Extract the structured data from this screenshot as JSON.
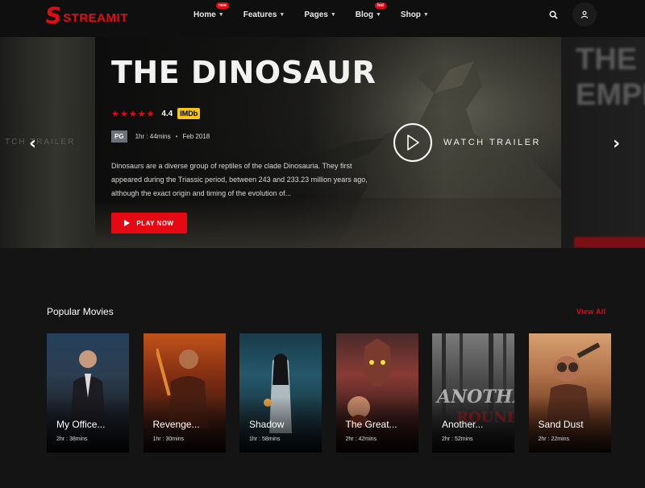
{
  "header": {
    "logo_letter": "S",
    "logo_text": "STREAMIT",
    "nav": [
      {
        "label": "Home",
        "badge": "new"
      },
      {
        "label": "Features",
        "badge": ""
      },
      {
        "label": "Pages",
        "badge": ""
      },
      {
        "label": "Blog",
        "badge": "hot"
      },
      {
        "label": "Shop",
        "badge": ""
      }
    ]
  },
  "hero": {
    "title": "THE DINOSAUR",
    "stars": "★★★★★",
    "rating": "4.4",
    "imdb": "IMDb",
    "certificate": "PG",
    "duration": "1hr : 44mins",
    "date": "Feb 2018",
    "description": "Dinosaurs are a diverse group of reptiles of the clade Dinosauria. They first appeared during the Triassic period, between 243 and 233.23 million years ago, although the exact origin and timing of the evolution of...",
    "play_label": "PLAY NOW",
    "trailer_label": "WATCH TRAILER",
    "prev_ghost": "TCH TRAILER",
    "next_ghost": "THE EMPI"
  },
  "popular": {
    "title": "Popular Movies",
    "view_all": "View All",
    "movies": [
      {
        "title": "My Office...",
        "duration": "2hr : 38mins"
      },
      {
        "title": "Revenge...",
        "duration": "1hr : 30mins"
      },
      {
        "title": "Shadow",
        "duration": "1hr : 58mins"
      },
      {
        "title": "The Great...",
        "duration": "2hr : 42mins"
      },
      {
        "title": "Another...",
        "duration": "2hr : 52mins"
      },
      {
        "title": "Sand Dust",
        "duration": "2hr : 22mins"
      }
    ]
  },
  "colors": {
    "accent": "#e50914",
    "imdb": "#f5c518",
    "background": "#141414"
  }
}
